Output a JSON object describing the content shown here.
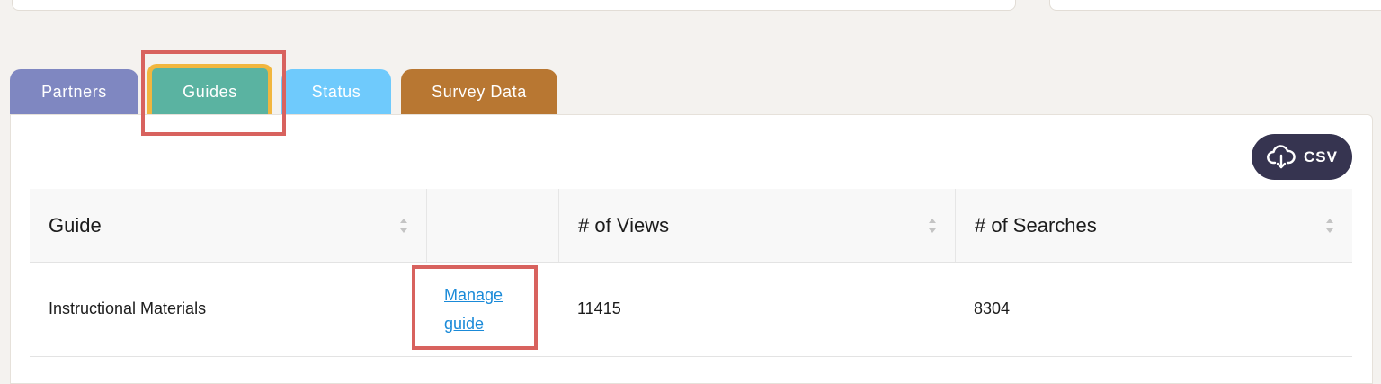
{
  "tabs": [
    {
      "label": "Partners"
    },
    {
      "label": "Guides"
    },
    {
      "label": "Status"
    },
    {
      "label": "Survey Data"
    }
  ],
  "active_tab": "Guides",
  "toolbar": {
    "csv_label": "CSV",
    "csv_icon": "cloud-download-icon"
  },
  "table": {
    "headers": [
      "Guide",
      "",
      "# of Views",
      "# of Searches"
    ],
    "rows": [
      {
        "guide": "Instructional Materials",
        "action": "Manage guide",
        "views": "11415",
        "searches": "8304"
      }
    ]
  },
  "colors": {
    "tab_partners": "#7f87c1",
    "tab_guides": "#5ab3a1",
    "tab_status": "#6fcafc",
    "tab_survey": "#b87732",
    "active_tab_border": "#f1b63f",
    "highlight": "#d8625e",
    "csv_button": "#363450",
    "link": "#1a8ad8"
  }
}
